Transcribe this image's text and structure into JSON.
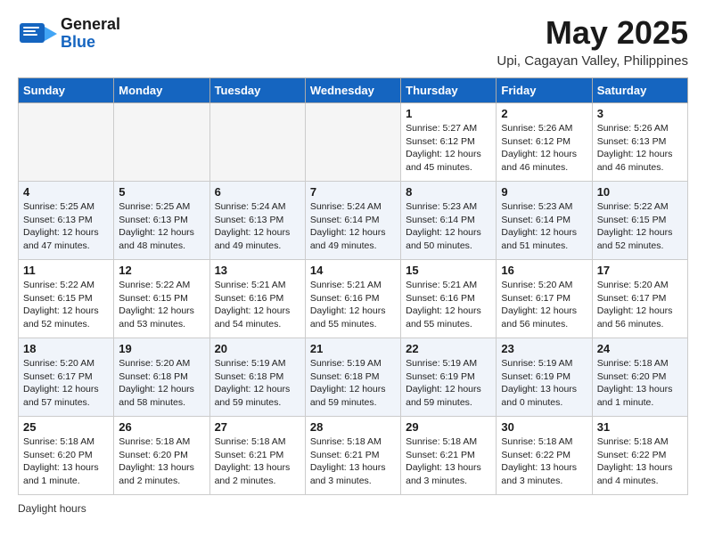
{
  "header": {
    "logo_line1": "General",
    "logo_line2": "Blue",
    "month_title": "May 2025",
    "subtitle": "Upi, Cagayan Valley, Philippines"
  },
  "days_of_week": [
    "Sunday",
    "Monday",
    "Tuesday",
    "Wednesday",
    "Thursday",
    "Friday",
    "Saturday"
  ],
  "weeks": [
    [
      {
        "day": "",
        "info": ""
      },
      {
        "day": "",
        "info": ""
      },
      {
        "day": "",
        "info": ""
      },
      {
        "day": "",
        "info": ""
      },
      {
        "day": "1",
        "info": "Sunrise: 5:27 AM\nSunset: 6:12 PM\nDaylight: 12 hours\nand 45 minutes."
      },
      {
        "day": "2",
        "info": "Sunrise: 5:26 AM\nSunset: 6:12 PM\nDaylight: 12 hours\nand 46 minutes."
      },
      {
        "day": "3",
        "info": "Sunrise: 5:26 AM\nSunset: 6:13 PM\nDaylight: 12 hours\nand 46 minutes."
      }
    ],
    [
      {
        "day": "4",
        "info": "Sunrise: 5:25 AM\nSunset: 6:13 PM\nDaylight: 12 hours\nand 47 minutes."
      },
      {
        "day": "5",
        "info": "Sunrise: 5:25 AM\nSunset: 6:13 PM\nDaylight: 12 hours\nand 48 minutes."
      },
      {
        "day": "6",
        "info": "Sunrise: 5:24 AM\nSunset: 6:13 PM\nDaylight: 12 hours\nand 49 minutes."
      },
      {
        "day": "7",
        "info": "Sunrise: 5:24 AM\nSunset: 6:14 PM\nDaylight: 12 hours\nand 49 minutes."
      },
      {
        "day": "8",
        "info": "Sunrise: 5:23 AM\nSunset: 6:14 PM\nDaylight: 12 hours\nand 50 minutes."
      },
      {
        "day": "9",
        "info": "Sunrise: 5:23 AM\nSunset: 6:14 PM\nDaylight: 12 hours\nand 51 minutes."
      },
      {
        "day": "10",
        "info": "Sunrise: 5:22 AM\nSunset: 6:15 PM\nDaylight: 12 hours\nand 52 minutes."
      }
    ],
    [
      {
        "day": "11",
        "info": "Sunrise: 5:22 AM\nSunset: 6:15 PM\nDaylight: 12 hours\nand 52 minutes."
      },
      {
        "day": "12",
        "info": "Sunrise: 5:22 AM\nSunset: 6:15 PM\nDaylight: 12 hours\nand 53 minutes."
      },
      {
        "day": "13",
        "info": "Sunrise: 5:21 AM\nSunset: 6:16 PM\nDaylight: 12 hours\nand 54 minutes."
      },
      {
        "day": "14",
        "info": "Sunrise: 5:21 AM\nSunset: 6:16 PM\nDaylight: 12 hours\nand 55 minutes."
      },
      {
        "day": "15",
        "info": "Sunrise: 5:21 AM\nSunset: 6:16 PM\nDaylight: 12 hours\nand 55 minutes."
      },
      {
        "day": "16",
        "info": "Sunrise: 5:20 AM\nSunset: 6:17 PM\nDaylight: 12 hours\nand 56 minutes."
      },
      {
        "day": "17",
        "info": "Sunrise: 5:20 AM\nSunset: 6:17 PM\nDaylight: 12 hours\nand 56 minutes."
      }
    ],
    [
      {
        "day": "18",
        "info": "Sunrise: 5:20 AM\nSunset: 6:17 PM\nDaylight: 12 hours\nand 57 minutes."
      },
      {
        "day": "19",
        "info": "Sunrise: 5:20 AM\nSunset: 6:18 PM\nDaylight: 12 hours\nand 58 minutes."
      },
      {
        "day": "20",
        "info": "Sunrise: 5:19 AM\nSunset: 6:18 PM\nDaylight: 12 hours\nand 59 minutes."
      },
      {
        "day": "21",
        "info": "Sunrise: 5:19 AM\nSunset: 6:18 PM\nDaylight: 12 hours\nand 59 minutes."
      },
      {
        "day": "22",
        "info": "Sunrise: 5:19 AM\nSunset: 6:19 PM\nDaylight: 12 hours\nand 59 minutes."
      },
      {
        "day": "23",
        "info": "Sunrise: 5:19 AM\nSunset: 6:19 PM\nDaylight: 13 hours\nand 0 minutes."
      },
      {
        "day": "24",
        "info": "Sunrise: 5:18 AM\nSunset: 6:20 PM\nDaylight: 13 hours\nand 1 minute."
      }
    ],
    [
      {
        "day": "25",
        "info": "Sunrise: 5:18 AM\nSunset: 6:20 PM\nDaylight: 13 hours\nand 1 minute."
      },
      {
        "day": "26",
        "info": "Sunrise: 5:18 AM\nSunset: 6:20 PM\nDaylight: 13 hours\nand 2 minutes."
      },
      {
        "day": "27",
        "info": "Sunrise: 5:18 AM\nSunset: 6:21 PM\nDaylight: 13 hours\nand 2 minutes."
      },
      {
        "day": "28",
        "info": "Sunrise: 5:18 AM\nSunset: 6:21 PM\nDaylight: 13 hours\nand 3 minutes."
      },
      {
        "day": "29",
        "info": "Sunrise: 5:18 AM\nSunset: 6:21 PM\nDaylight: 13 hours\nand 3 minutes."
      },
      {
        "day": "30",
        "info": "Sunrise: 5:18 AM\nSunset: 6:22 PM\nDaylight: 13 hours\nand 3 minutes."
      },
      {
        "day": "31",
        "info": "Sunrise: 5:18 AM\nSunset: 6:22 PM\nDaylight: 13 hours\nand 4 minutes."
      }
    ]
  ],
  "footer": {
    "note": "Daylight hours"
  }
}
